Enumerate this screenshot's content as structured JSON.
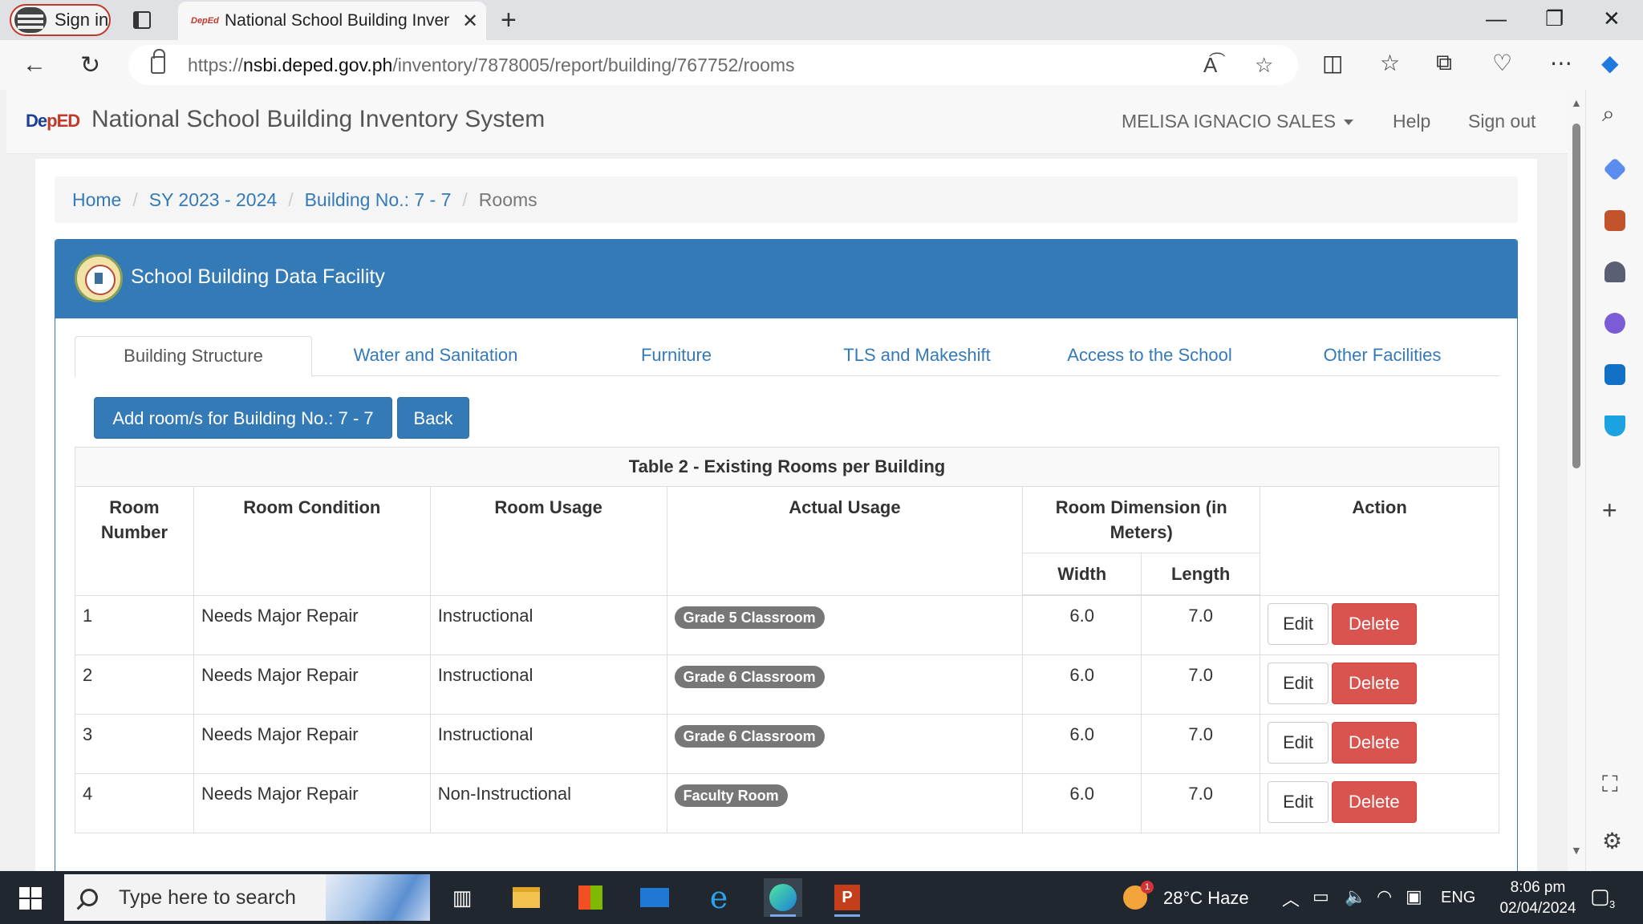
{
  "browser": {
    "signin_label": "Sign in",
    "tab_title": "National School Building Invento",
    "new_tab": "+",
    "url_scheme": "https://",
    "url_host": "nsbi.deped.gov.ph",
    "url_path": "/inventory/7878005/report/building/767752/rooms",
    "favicon_text": "DepEd"
  },
  "site": {
    "logo_main": "De",
    "logo_accent": "pED",
    "title": "National School Building Inventory System",
    "user": "MELISA IGNACIO SALES",
    "help": "Help",
    "signout": "Sign out"
  },
  "breadcrumb": {
    "items": [
      "Home",
      "SY 2023 - 2024",
      "Building No.: 7 - 7"
    ],
    "active": "Rooms"
  },
  "panel": {
    "title": "School Building Data Facility"
  },
  "tabs": [
    {
      "label": "Building Structure",
      "active": true
    },
    {
      "label": "Water and Sanitation",
      "active": false
    },
    {
      "label": "Furniture",
      "active": false
    },
    {
      "label": "TLS and Makeshift",
      "active": false
    },
    {
      "label": "Access to the School",
      "active": false
    },
    {
      "label": "Other Facilities",
      "active": false
    }
  ],
  "actions": {
    "add_room": "Add room/s for Building No.: 7 - 7",
    "back": "Back"
  },
  "table": {
    "caption": "Table 2 - Existing Rooms per Building",
    "headers": {
      "room_number": "Room Number",
      "room_condition": "Room Condition",
      "room_usage": "Room Usage",
      "actual_usage": "Actual Usage",
      "dimension": "Room Dimension (in Meters)",
      "width": "Width",
      "length": "Length",
      "action": "Action"
    },
    "rows": [
      {
        "number": "1",
        "condition": "Needs Major Repair",
        "usage": "Instructional",
        "actual": "Grade 5 Classroom",
        "width": "6.0",
        "length": "7.0"
      },
      {
        "number": "2",
        "condition": "Needs Major Repair",
        "usage": "Instructional",
        "actual": "Grade 6 Classroom",
        "width": "6.0",
        "length": "7.0"
      },
      {
        "number": "3",
        "condition": "Needs Major Repair",
        "usage": "Instructional",
        "actual": "Grade 6 Classroom",
        "width": "6.0",
        "length": "7.0"
      },
      {
        "number": "4",
        "condition": "Needs Major Repair",
        "usage": "Non-Instructional",
        "actual": "Faculty Room",
        "width": "6.0",
        "length": "7.0"
      }
    ],
    "edit_label": "Edit",
    "delete_label": "Delete"
  },
  "taskbar": {
    "search_placeholder": "Type here to search",
    "weather_badge": "1",
    "weather": "28°C  Haze",
    "language": "ENG",
    "time": "8:06 pm",
    "date": "02/04/2024",
    "notifications": "3",
    "pp_letter": "P"
  },
  "colors": {
    "primary": "#337ab7",
    "danger": "#d9534f",
    "badge": "#777777"
  }
}
